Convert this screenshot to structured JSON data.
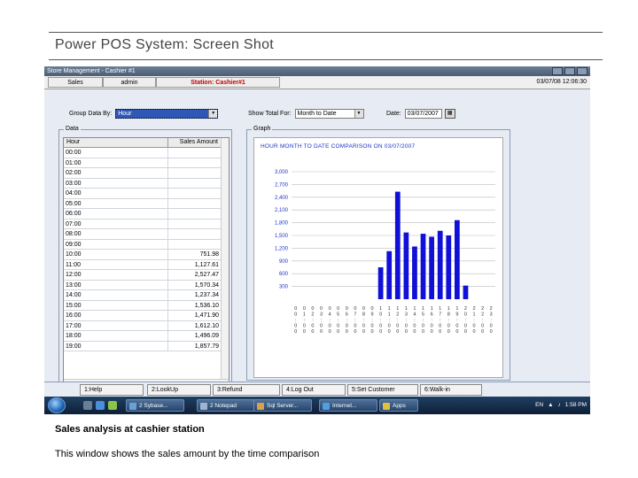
{
  "slide": {
    "title": "Power POS System: Screen Shot",
    "caption_bold": "Sales analysis at cashier station",
    "caption": "This window shows the sales amount by the time comparison"
  },
  "window": {
    "title": "Store Management - Cashier #1"
  },
  "status": {
    "section": "Sales",
    "user": "admin",
    "station": "Station: Cashier#1",
    "datetime": "03/07/08 12:06:30"
  },
  "controls": {
    "group_label": "Group Data By:",
    "group_value": "Hour",
    "show_label": "Show Total For:",
    "show_value": "Month to Date",
    "date_label": "Date:",
    "date_value": "03/07/2007",
    "calendar_icon": "calendar-icon"
  },
  "data_panel": {
    "label": "Data",
    "columns": [
      "Hour",
      "Sales Amount"
    ],
    "rows": [
      {
        "hour": "00:00",
        "amount": ""
      },
      {
        "hour": "01:00",
        "amount": ""
      },
      {
        "hour": "02:00",
        "amount": ""
      },
      {
        "hour": "03:00",
        "amount": ""
      },
      {
        "hour": "04:00",
        "amount": ""
      },
      {
        "hour": "05:00",
        "amount": ""
      },
      {
        "hour": "06:00",
        "amount": ""
      },
      {
        "hour": "07:00",
        "amount": ""
      },
      {
        "hour": "08:00",
        "amount": ""
      },
      {
        "hour": "09:00",
        "amount": ""
      },
      {
        "hour": "10:00",
        "amount": "751.98"
      },
      {
        "hour": "11:00",
        "amount": "1,127.61"
      },
      {
        "hour": "12:00",
        "amount": "2,527.47"
      },
      {
        "hour": "13:00",
        "amount": "1,570.34"
      },
      {
        "hour": "14:00",
        "amount": "1,237.34"
      },
      {
        "hour": "15:00",
        "amount": "1,536.10"
      },
      {
        "hour": "16:00",
        "amount": "1,471.90"
      },
      {
        "hour": "17:00",
        "amount": "1,612.10"
      },
      {
        "hour": "18:00",
        "amount": "1,496.09"
      },
      {
        "hour": "19:00",
        "amount": "1,857.79"
      }
    ]
  },
  "graph_panel": {
    "label": "Graph"
  },
  "chart_data": {
    "type": "bar",
    "title": "HOUR MONTH TO DATE COMPARISON ON 03/07/2007",
    "categories": [
      "00:00",
      "01:00",
      "02:00",
      "03:00",
      "04:00",
      "05:00",
      "06:00",
      "07:00",
      "08:00",
      "09:00",
      "10:00",
      "11:00",
      "12:00",
      "13:00",
      "14:00",
      "15:00",
      "16:00",
      "17:00",
      "18:00",
      "19:00",
      "20:00",
      "21:00",
      "22:00",
      "23:00"
    ],
    "values": [
      0,
      0,
      0,
      0,
      0,
      0,
      0,
      0,
      0,
      0,
      750,
      1130,
      2530,
      1570,
      1240,
      1540,
      1470,
      1610,
      1500,
      1860,
      320,
      0,
      0,
      0
    ],
    "yticks": [
      "300",
      "600",
      "900",
      "1,200",
      "1,500",
      "1,800",
      "2,100",
      "2,400",
      "2,700",
      "3,000"
    ],
    "ylim": [
      0,
      3000
    ],
    "bar_color": "#1010d8",
    "grid": true
  },
  "tabs": [
    {
      "label": "1:Help"
    },
    {
      "label": "2:LookUp"
    },
    {
      "label": "3:Refund"
    },
    {
      "label": "4:Log Out"
    },
    {
      "label": "5:Set Customer"
    },
    {
      "label": "6:Walk-in"
    }
  ],
  "taskbar": {
    "tasks": [
      {
        "label": "2 Sybase...",
        "color": "#6aa0d8"
      },
      {
        "label": "2 Notepad",
        "color": "#9fb4d0"
      },
      {
        "label": "Sql Server...",
        "color": "#d9a04a"
      },
      {
        "label": "Internet...",
        "color": "#4ea0e0"
      },
      {
        "label": "Apps",
        "color": "#e0c040"
      }
    ],
    "lang": "EN",
    "clock": "1:58 PM"
  }
}
